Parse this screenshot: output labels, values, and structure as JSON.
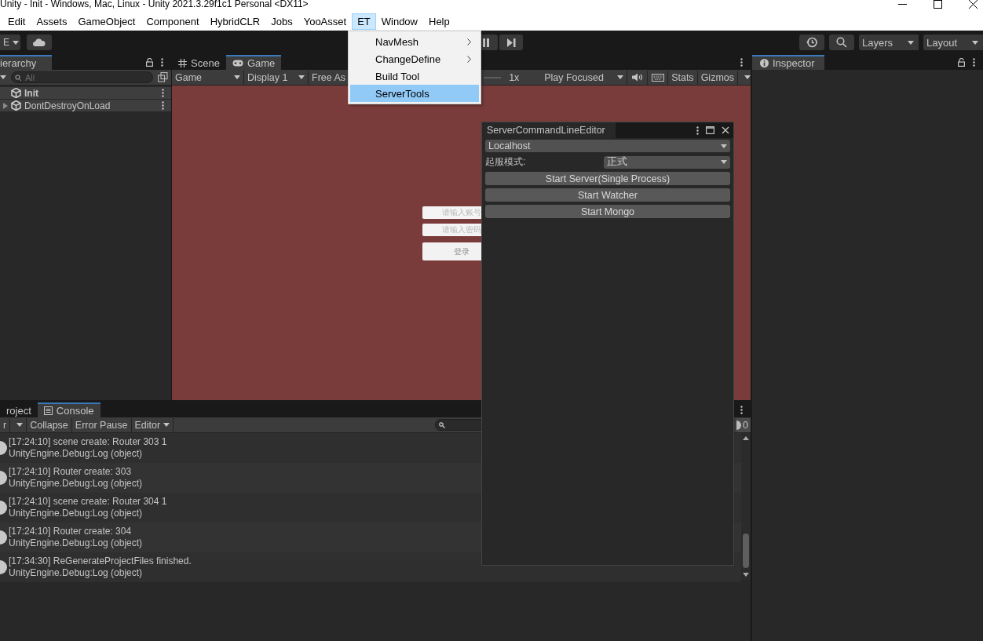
{
  "window": {
    "title": "Unity - Init - Windows, Mac, Linux - Unity 2021.3.29f1c1 Personal <DX11>"
  },
  "menu_bar": [
    {
      "label": "Edit",
      "selected": false
    },
    {
      "label": "Assets",
      "selected": false
    },
    {
      "label": "GameObject",
      "selected": false
    },
    {
      "label": "Component",
      "selected": false
    },
    {
      "label": "HybridCLR",
      "selected": false
    },
    {
      "label": "Jobs",
      "selected": false
    },
    {
      "label": "YooAsset",
      "selected": false
    },
    {
      "label": "ET",
      "selected": true
    },
    {
      "label": "Window",
      "selected": false
    },
    {
      "label": "Help",
      "selected": false
    }
  ],
  "menu": {
    "items": [
      {
        "label": "NavMesh",
        "submenu": true,
        "selected": false
      },
      {
        "label": "ChangeDefine",
        "submenu": true,
        "selected": false
      },
      {
        "label": "Build Tool",
        "submenu": false,
        "selected": false
      },
      {
        "label": "ServerTools",
        "submenu": false,
        "selected": true
      }
    ]
  },
  "toolbar": {
    "account": "E",
    "layers": "Layers",
    "layout": "Layout"
  },
  "hierarchy": {
    "tab": "ierarchy",
    "search_placeholder": "All",
    "items": [
      {
        "label": "Init",
        "active": true,
        "expandable": false
      },
      {
        "label": "DontDestroyOnLoad",
        "active": false,
        "expandable": true
      }
    ]
  },
  "game_view": {
    "tabs": [
      {
        "label": "Scene",
        "kind": "scene",
        "selected": false
      },
      {
        "label": "Game",
        "kind": "game",
        "selected": true
      }
    ],
    "toolbar": {
      "view": "Game",
      "display": "Display 1",
      "aspect": "Free As",
      "scale": "1x",
      "play_mode": "Play Focused",
      "stats": "Stats",
      "gizmos": "Gizmos"
    },
    "login": {
      "account_placeholder": "请输入账号",
      "password_placeholder": "请输入密码",
      "button": "登录"
    }
  },
  "inspector": {
    "tab": "Inspector"
  },
  "console": {
    "tabs": [
      {
        "label": "roject",
        "kind": "project",
        "selected": false
      },
      {
        "label": "Console",
        "kind": "console",
        "selected": true
      }
    ],
    "toolbar": {
      "clear": "r",
      "collapse": "Collapse",
      "error_pause": "Error Pause",
      "editor": "Editor"
    },
    "count": "0",
    "entries": [
      {
        "message": "[17:24:10] scene create: Router 303 1",
        "trace": "UnityEngine.Debug:Log (object)"
      },
      {
        "message": "[17:24:10] Router create: 303",
        "trace": "UnityEngine.Debug:Log (object)"
      },
      {
        "message": "[17:24:10] scene create: Router 304 1",
        "trace": "UnityEngine.Debug:Log (object)"
      },
      {
        "message": "[17:24:10] Router create: 304",
        "trace": "UnityEngine.Debug:Log (object)"
      },
      {
        "message": "[17:34:30] ReGenerateProjectFiles finished.",
        "trace": "UnityEngine.Debug:Log (object)"
      }
    ]
  },
  "editor_window": {
    "title": "ServerCommandLineEditor",
    "host": "Localhost",
    "mode_label": "起服模式:",
    "mode": "正式",
    "buttons": [
      "Start Server(Single Process)",
      "Start Watcher",
      "Start Mongo"
    ]
  }
}
